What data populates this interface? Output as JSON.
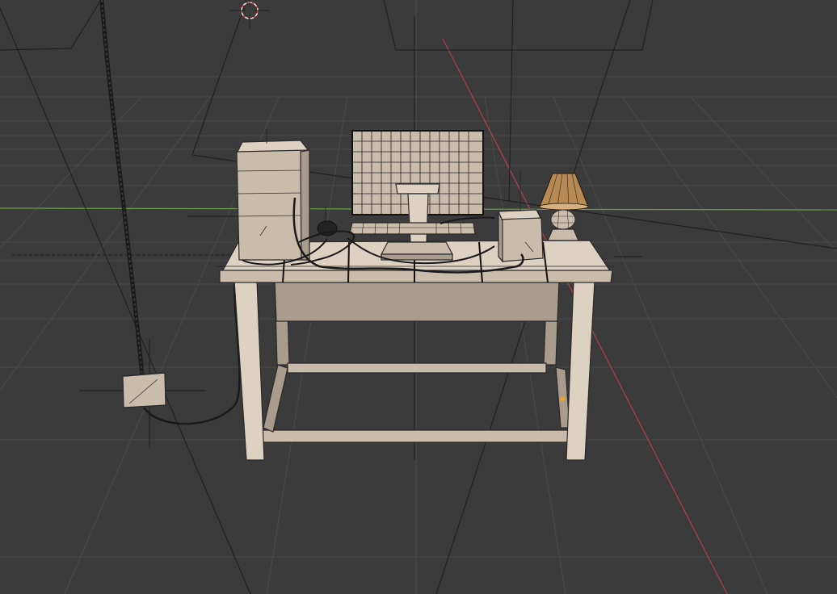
{
  "viewport": {
    "background": "#3b3b3b",
    "grid_color": "#4a4a4a",
    "x_axis_color": "#b0404a",
    "y_axis_color": "#6a9a4a",
    "mesh_color": "#c9bcab",
    "selection_dot_color": "#f0a020"
  },
  "scene_objects": [
    "3d-cursor",
    "desk",
    "pc-tower",
    "monitor",
    "keyboard",
    "mouse",
    "speaker-box",
    "table-lamp",
    "power-box",
    "power-cable",
    "camera-frustum-lines"
  ]
}
